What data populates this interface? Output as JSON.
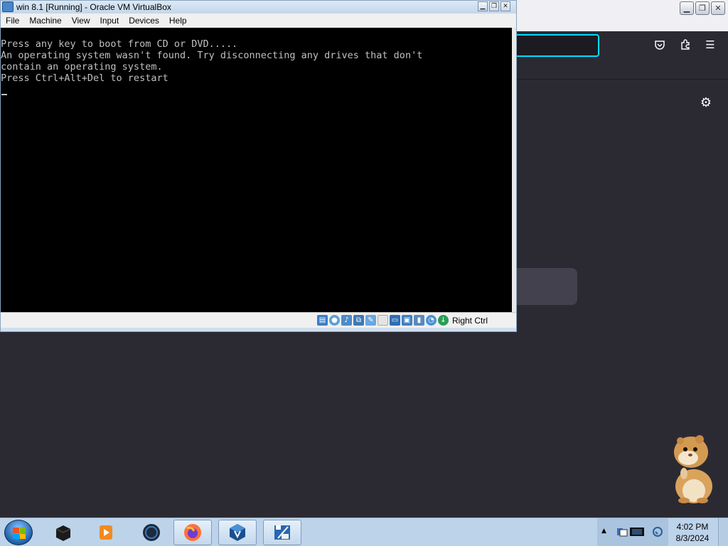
{
  "virtualbox": {
    "title": "win 8.1 [Running] - Oracle VM VirtualBox",
    "menu": [
      "File",
      "Machine",
      "View",
      "Input",
      "Devices",
      "Help"
    ],
    "console_lines": [
      "Press any key to boot from CD or DVD.....",
      "An operating system wasn't found. Try disconnecting any drives that don't",
      "contain an operating system.",
      "Press Ctrl+Alt+Del to restart"
    ],
    "host_key": "Right Ctrl",
    "status_icons": [
      "hard-disk-icon",
      "optical-drive-icon",
      "audio-icon",
      "network-icon",
      "usb-icon",
      "shared-folders-icon",
      "display-icon",
      "video-capture-icon",
      "virtualization-icon",
      "mouse-integration-icon",
      "keyboard-icon"
    ]
  },
  "firefox": {
    "toolbar_icons": [
      "pocket-icon",
      "extensions-icon",
      "menu-icon"
    ],
    "settings_icon": "gear-icon"
  },
  "taskbar": {
    "apps": [
      {
        "name": "black-box-app-icon",
        "active": false
      },
      {
        "name": "media-player-icon",
        "active": false
      },
      {
        "name": "blue-sphere-app-icon",
        "active": false
      },
      {
        "name": "firefox-icon",
        "active": true
      },
      {
        "name": "virtualbox-icon",
        "active": true
      },
      {
        "name": "win81-vm-icon",
        "active": true
      }
    ],
    "clock": {
      "time": "4:02 PM",
      "date": "8/3/2024"
    }
  },
  "colors": {
    "accent": "#00ddff",
    "console_text": "#c0c0c0",
    "firefox_bg": "#2b2a33",
    "taskbar": "#bdd3ea"
  }
}
